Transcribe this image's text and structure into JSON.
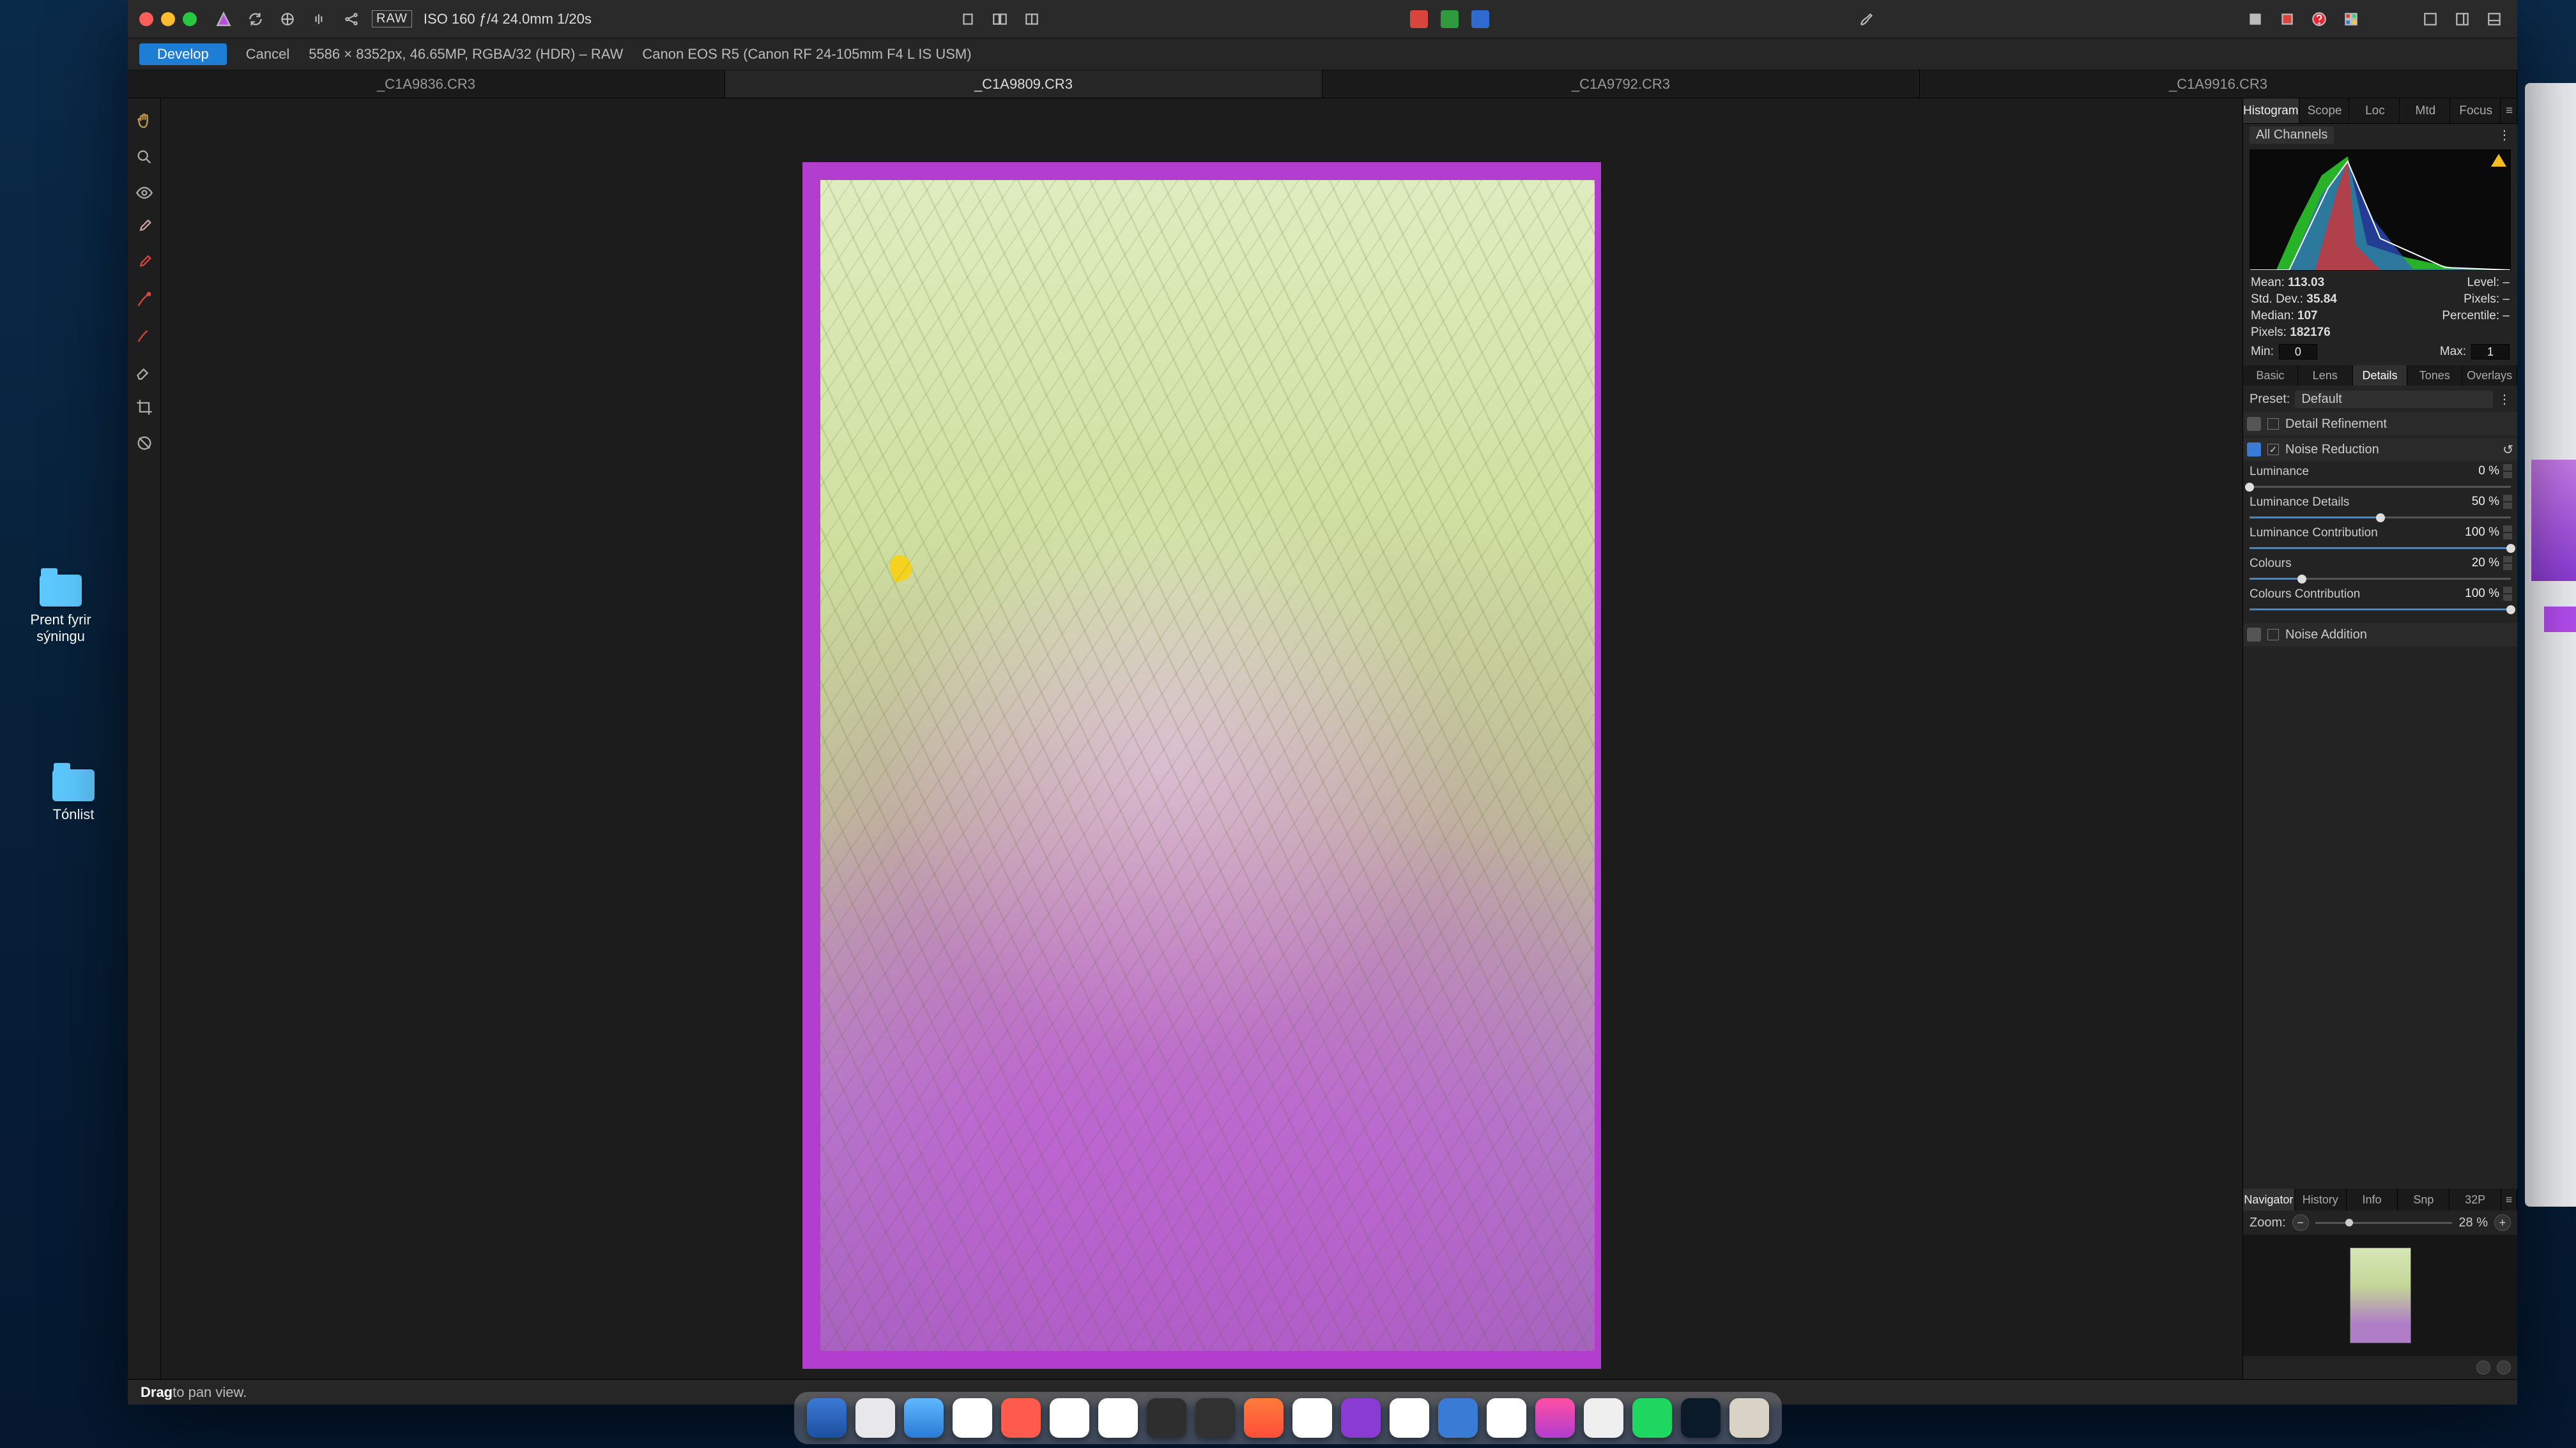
{
  "desktop": {
    "folder1": "Prent fyrir sýningu",
    "folder2": "Tónlist"
  },
  "top": {
    "raw_badge": "RAW",
    "iso_info": "ISO 160 ƒ/4 24.0mm 1/20s"
  },
  "subbar": {
    "develop": "Develop",
    "cancel": "Cancel",
    "dims": "5586 × 8352px, 46.65MP, RGBA/32 (HDR) – RAW",
    "lens": "Canon EOS R5 (Canon RF 24-105mm F4 L IS USM)"
  },
  "filetabs": [
    "_C1A9836.CR3",
    "_C1A9809.CR3",
    "_C1A9792.CR3",
    "_C1A9916.CR3"
  ],
  "filetabs_active": 1,
  "right": {
    "toptabs": [
      "Histogram",
      "Scope",
      "Loc",
      "Mtd",
      "Focus"
    ],
    "channels_dd": "All Channels",
    "stats": {
      "mean_l": "Mean:",
      "mean_v": "113.03",
      "std_l": "Std. Dev.:",
      "std_v": "35.84",
      "med_l": "Median:",
      "med_v": "107",
      "pix_l": "Pixels:",
      "pix_v": "182176",
      "lvl_l": "Level:",
      "lvl_v": "–",
      "pixc_l": "Pixels:",
      "pixc_v": "–",
      "pct_l": "Percentile:",
      "pct_v": "–",
      "min_l": "Min:",
      "min_v": "0",
      "max_l": "Max:",
      "max_v": "1"
    },
    "devtabs": [
      "Basic",
      "Lens",
      "Details",
      "Tones",
      "Overlays"
    ],
    "devtabs_active": 2,
    "preset_l": "Preset:",
    "preset_v": "Default",
    "panel_detail": "Detail Refinement",
    "panel_noise": "Noise Reduction",
    "panel_noiseadd": "Noise Addition",
    "sliders": [
      {
        "label": "Luminance",
        "value": "0 %",
        "pct": 0
      },
      {
        "label": "Luminance Details",
        "value": "50 %",
        "pct": 50
      },
      {
        "label": "Luminance Contribution",
        "value": "100 %",
        "pct": 100
      },
      {
        "label": "Colours",
        "value": "20 %",
        "pct": 20
      },
      {
        "label": "Colours Contribution",
        "value": "100 %",
        "pct": 100
      }
    ],
    "navtabs": [
      "Navigator",
      "History",
      "Info",
      "Snp",
      "32P"
    ],
    "zoom_l": "Zoom:",
    "zoom_v": "28 %"
  },
  "status": {
    "hint_b": "Drag",
    "hint": " to pan view."
  }
}
